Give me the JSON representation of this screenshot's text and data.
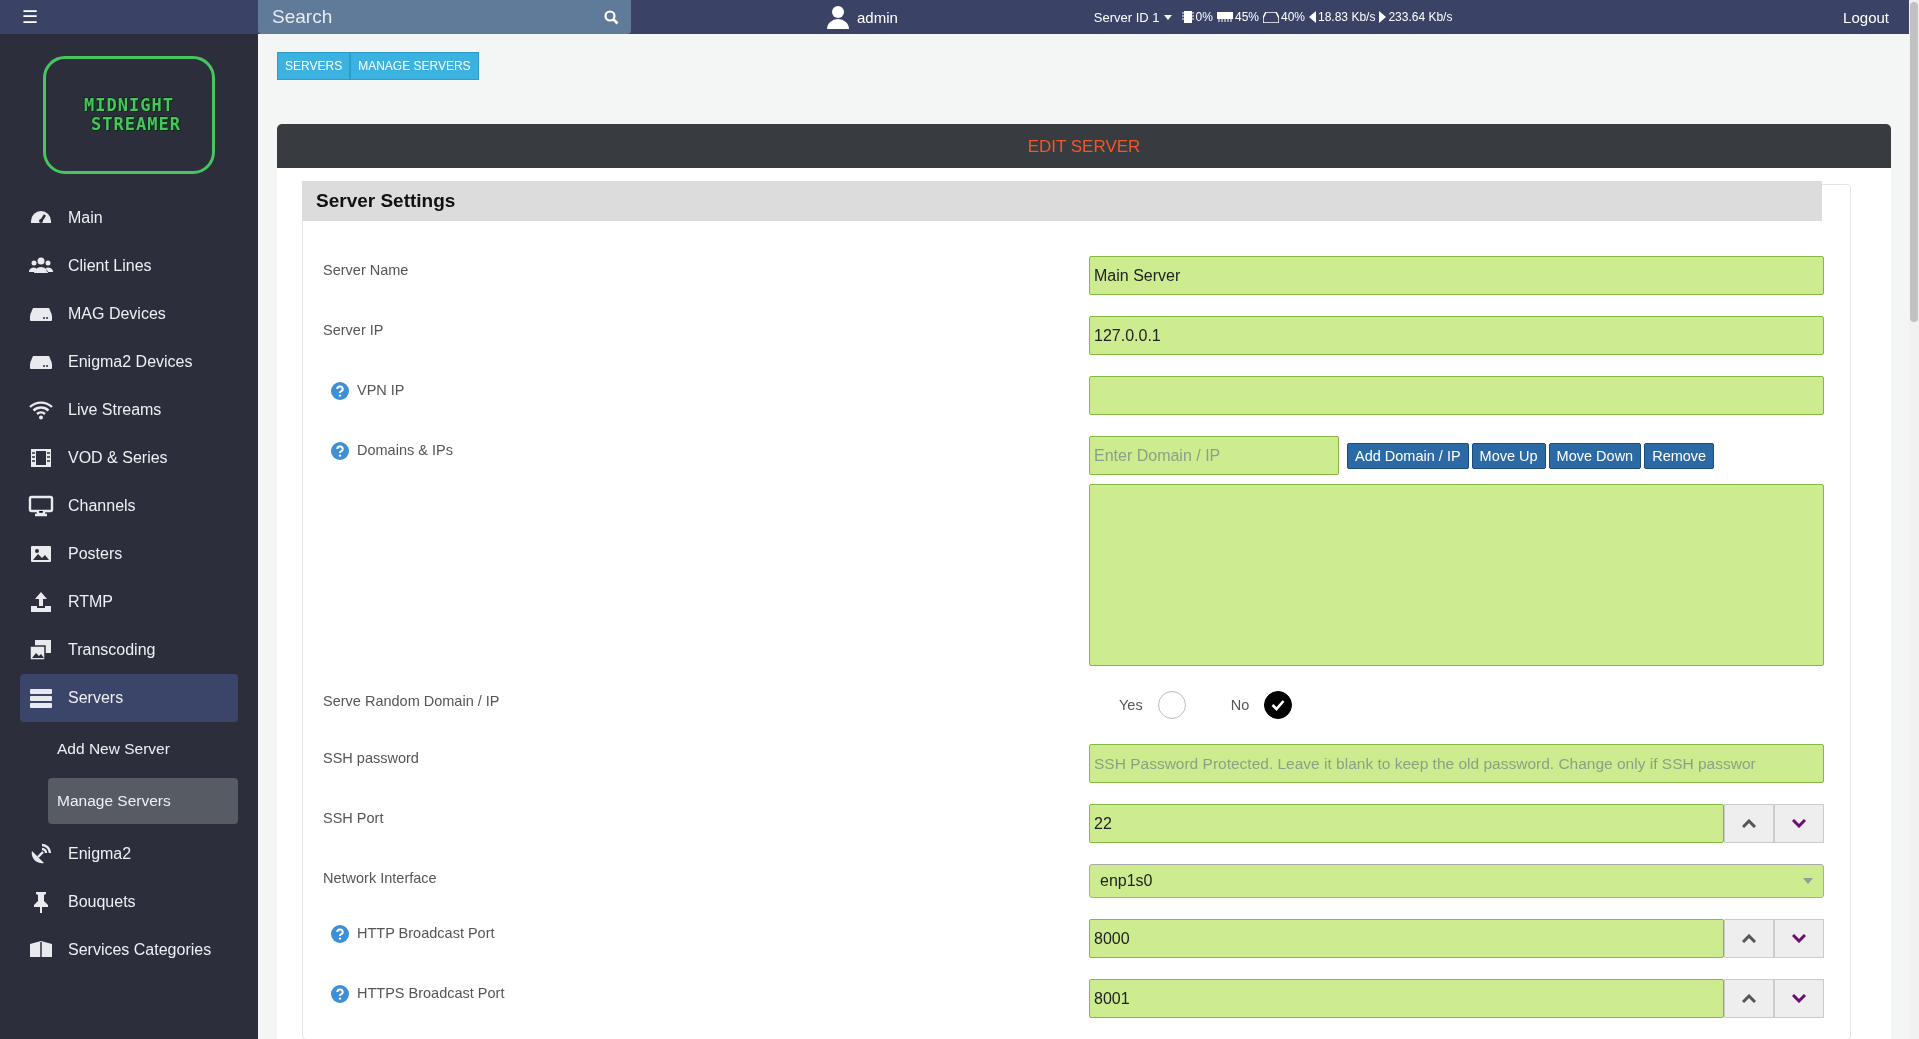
{
  "topbar": {
    "menu_glyph": "☰",
    "search": {
      "placeholder": "Search"
    },
    "user": "admin",
    "server": "Server ID 1",
    "stats": [
      {
        "kind": "cpu",
        "text": "0%"
      },
      {
        "kind": "ram",
        "text": "45%"
      },
      {
        "kind": "disk",
        "text": "40%"
      },
      {
        "kind": "down",
        "text": "18.83 Kb/s"
      },
      {
        "kind": "up",
        "text": "233.64 Kb/s"
      }
    ],
    "logout": "Logout"
  },
  "logo": {
    "line_1": "MIDNIGHT",
    "line_2": "STREAMER"
  },
  "sidebar": {
    "items": [
      {
        "label": "Main",
        "selected": false
      },
      {
        "label": "Client Lines",
        "selected": false
      },
      {
        "label": "MAG Devices",
        "selected": false
      },
      {
        "label": "Enigma2 Devices",
        "selected": false
      },
      {
        "label": "Live Streams",
        "selected": false
      },
      {
        "label": "VOD & Series",
        "selected": false
      },
      {
        "label": "Channels",
        "selected": false
      },
      {
        "label": "Posters",
        "selected": false
      },
      {
        "label": "RTMP",
        "selected": false
      },
      {
        "label": "Transcoding",
        "selected": false
      },
      {
        "label": "Servers",
        "selected": true,
        "children": [
          {
            "label": "Add New Server",
            "selected": false
          },
          {
            "label": "Manage Servers",
            "selected": true
          }
        ]
      },
      {
        "label": "Enigma2",
        "selected": false
      },
      {
        "label": "Bouquets",
        "selected": false
      },
      {
        "label": "Services Categories",
        "selected": false
      }
    ]
  },
  "breadcrumb": [
    "SERVERS",
    "MANAGE SERVERS"
  ],
  "card": {
    "title": "EDIT SERVER",
    "section": "Server Settings",
    "fields": [
      {
        "kind": "text",
        "label": "Server Name",
        "help": false,
        "value": "Main Server"
      },
      {
        "kind": "text",
        "label": "Server IP",
        "help": false,
        "value": "127.0.0.1"
      },
      {
        "kind": "text",
        "label": "VPN IP",
        "help": true
      },
      {
        "kind": "list",
        "label": "Domains & IPs",
        "help": true,
        "placeholder": "Enter Domain / IP",
        "buttons": [
          "Add Domain / IP",
          "Move Up",
          "Move Down",
          "Remove"
        ]
      },
      {
        "kind": "radio",
        "label": "Serve Random Domain / IP",
        "help": false,
        "options": [
          {
            "label": "Yes",
            "selected": false
          },
          {
            "label": "No",
            "selected": true
          }
        ]
      },
      {
        "kind": "text",
        "label": "SSH password",
        "help": false,
        "placeholder": "SSH Password Protected. Leave it blank to keep the old password. Change only if SSH passwor"
      },
      {
        "kind": "number",
        "label": "SSH Port",
        "help": false,
        "value": "22"
      },
      {
        "kind": "select",
        "label": "Network Interface",
        "help": false,
        "value": "enp1s0"
      },
      {
        "kind": "number",
        "label": "HTTP Broadcast Port",
        "help": true,
        "value": "8000"
      },
      {
        "kind": "number",
        "label": "HTTPS Broadcast Port",
        "help": true,
        "value": "8001"
      }
    ]
  }
}
